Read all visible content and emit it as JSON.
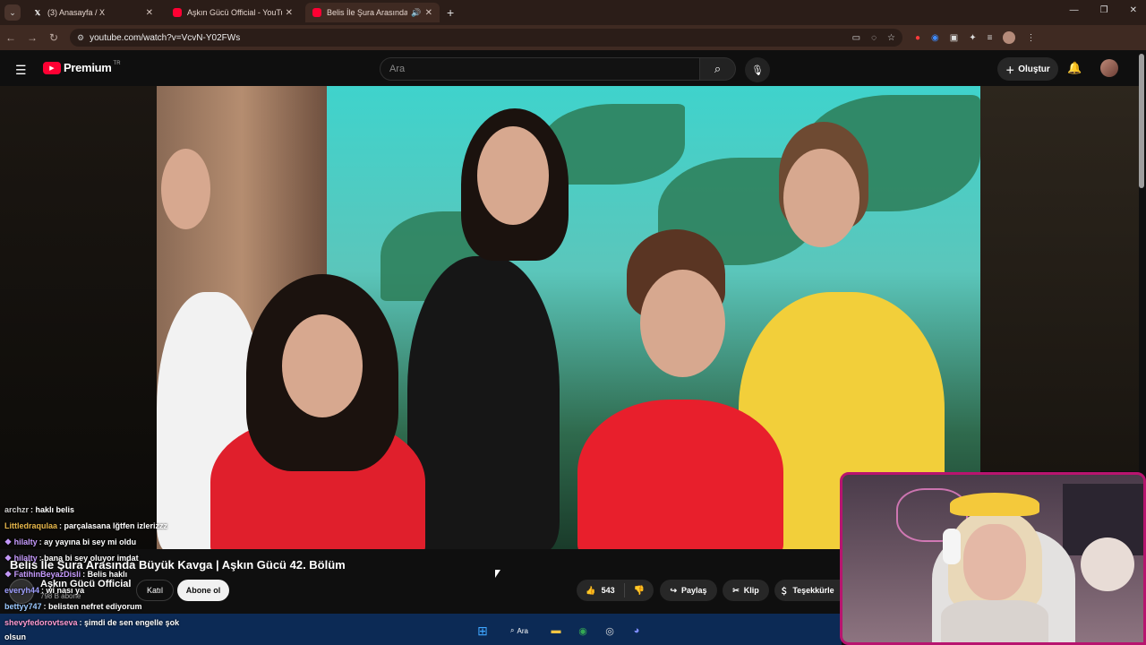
{
  "browser": {
    "tabs": [
      {
        "label": "(3) Anasayfa / X",
        "icon": "x-icon"
      },
      {
        "label": "Aşkın Gücü Official - YouTube",
        "icon": "youtube-icon"
      },
      {
        "label": "Belis İle Şura Arasında Büyü",
        "icon": "youtube-icon",
        "active": true
      }
    ],
    "url": "youtube.com/watch?v=VcvN-Y02FWs"
  },
  "youtube": {
    "logo_text": "Premium",
    "region": "TR",
    "search_placeholder": "Ara",
    "create_label": "Oluştur"
  },
  "video": {
    "title": "Belis İle Şura Arasında Büyük Kavga | Aşkın Gücü 42. Bölüm",
    "channel": "Aşkın Gücü Official",
    "subscribers": "798 B abone",
    "join_label": "Katıl",
    "subscribe_label": "Abone ol",
    "likes": "543",
    "share_label": "Paylaş",
    "clip_label": "Klip",
    "thanks_label": "Teşekkürle"
  },
  "chat": [
    {
      "user": "archzr",
      "msg": "haklı belis",
      "color": "#cccccc"
    },
    {
      "user": "Littledraqulaa",
      "msg": "parçalasana lğtfen izlerizzz",
      "color": "#e6b64a"
    },
    {
      "user": "hilalty",
      "msg": "ay yayına bi sey mi oldu",
      "color": "#c79bff"
    },
    {
      "user": "hilalty",
      "msg": "bana bi sey oluyor imdat",
      "color": "#c79bff"
    },
    {
      "user": "FatihinBeyazDisli",
      "msg": "Belis haklı",
      "color": "#c79bff"
    },
    {
      "user": "everyh44",
      "msg": "wi nası ya",
      "color": "#a0a0ff"
    },
    {
      "user": "bettyy747",
      "msg": "belisten nefret ediyorum",
      "color": "#9bc9ff"
    },
    {
      "user": "shevyfedorovtseva",
      "msg": "şimdi de sen engelle şok",
      "color": "#ff9bd1"
    },
    {
      "user": "",
      "msg": "olsun",
      "color": "#ffffff"
    }
  ],
  "taskbar": {
    "search_label": "Ara"
  },
  "colors": {
    "brand": "#ff0033",
    "stream_border": "#b8146f"
  }
}
